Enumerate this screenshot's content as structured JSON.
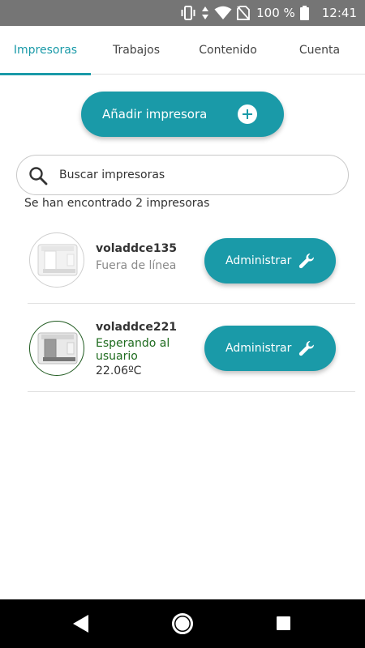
{
  "status_bar": {
    "battery": "100 %",
    "time": "12:41",
    "icons": [
      "vibrate-icon",
      "data-arrows-icon",
      "wifi-icon",
      "no-sim-icon",
      "battery-icon"
    ]
  },
  "tabs": [
    {
      "label": "Impresoras",
      "active": true
    },
    {
      "label": "Trabajos",
      "active": false
    },
    {
      "label": "Contenido",
      "active": false
    },
    {
      "label": "Cuenta",
      "active": false
    }
  ],
  "add_printer": {
    "label": "Añadir impresora",
    "icon": "plus-circle-icon"
  },
  "search": {
    "placeholder": "Buscar impresoras",
    "value": ""
  },
  "result_count": "Se han encontrado 2 impresoras",
  "printers": [
    {
      "name": "voladdce135",
      "status": "Fuera de línea",
      "temperature": "",
      "manage_label": "Administrar"
    },
    {
      "name": "voladdce221",
      "status": "Esperando al usuario",
      "temperature": "22.06ºC",
      "manage_label": "Administrar"
    }
  ],
  "colors": {
    "accent": "#1a9aa8",
    "status_bar": "#757575",
    "offline_text": "#8a8a8a",
    "waiting_text": "#1e6b1e",
    "nav_bar": "#000000"
  },
  "nav": {
    "icons": [
      "back-icon",
      "home-icon",
      "recents-icon"
    ]
  }
}
